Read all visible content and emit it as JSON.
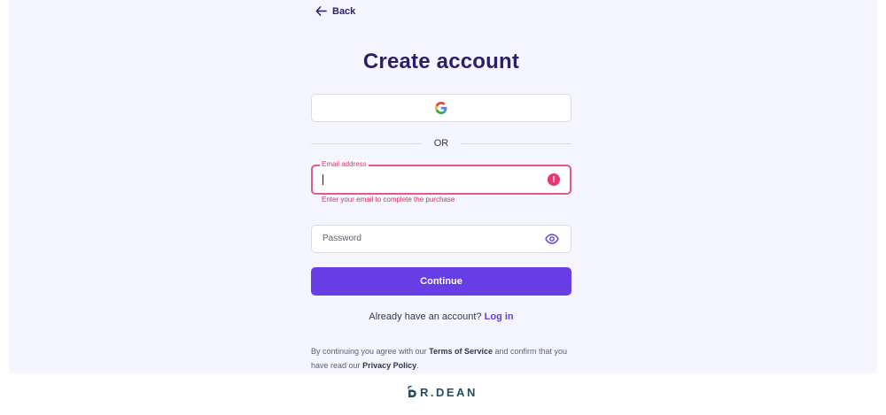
{
  "nav": {
    "back_label": "Back"
  },
  "header": {
    "title": "Create account"
  },
  "divider": {
    "label": "OR"
  },
  "email": {
    "label": "Email address",
    "value": "",
    "error": "Enter your email to complete the purchase",
    "error_icon": "!"
  },
  "password": {
    "placeholder": "Password"
  },
  "actions": {
    "continue_label": "Continue"
  },
  "login": {
    "prompt": "Already have an account?",
    "link": "Log in"
  },
  "terms": {
    "prefix": "By continuing you agree with our",
    "tos": "Terms of Service",
    "middle": "and confirm that you have read our",
    "privacy": "Privacy Policy",
    "suffix": "."
  },
  "branding": {
    "logo_text": "R.DEAN"
  },
  "colors": {
    "accent": "#673de6",
    "title": "#2f1c6a",
    "error": "#e8386f"
  }
}
